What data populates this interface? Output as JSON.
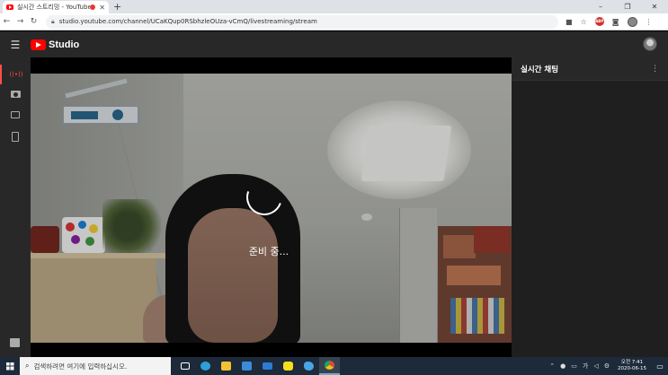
{
  "browser": {
    "tab_title": "실시간 스트리밍 - YouTube",
    "tab_close": "✕",
    "new_tab": "+",
    "window_controls": [
      "–",
      "❐",
      "✕"
    ],
    "url": "studio.youtube.com/channel/UCaKQup0RSbhzleOUza-vCmQ/livestreaming/stream",
    "adblock_badge": "ABP"
  },
  "studio": {
    "logo_text": "Studio",
    "hamburger": "☰"
  },
  "sidebar": {
    "items": [
      {
        "name": "stream",
        "icon": "live-broadcast-icon",
        "glyph": "((•))",
        "active": true
      },
      {
        "name": "webcam",
        "icon": "camera-icon",
        "active": false
      },
      {
        "name": "manage",
        "icon": "calendar-icon",
        "active": false
      },
      {
        "name": "mobile",
        "icon": "mobile-icon",
        "active": false
      }
    ],
    "feedback_icon": "feedback-icon"
  },
  "video": {
    "status_text": "준비 중..."
  },
  "chat": {
    "title": "실시간 채팅",
    "menu": "⋮"
  },
  "taskbar": {
    "search_placeholder": "검색하려면 여기에 입력하십시오.",
    "apps": [
      {
        "icon": "task-view-icon",
        "color": "#ffffff"
      },
      {
        "icon": "edge-icon",
        "color": "#2f9fd8"
      },
      {
        "icon": "file-explorer-icon",
        "color": "#f2c232"
      },
      {
        "icon": "store-icon",
        "color": "#3d8ad9"
      },
      {
        "icon": "mail-icon",
        "color": "#2c7cd6"
      },
      {
        "icon": "kakaotalk-icon",
        "color": "#f7df1e"
      },
      {
        "icon": "twitter-icon",
        "color": "#4aa3e6"
      },
      {
        "icon": "chrome-icon",
        "color": "#dd4b39"
      }
    ],
    "tray": {
      "ime": "가",
      "time_label": "오전 7:41",
      "date": "2020-06-15"
    }
  },
  "colors": {
    "studio_bg": "#282828",
    "accent": "#ff4e45",
    "taskbar": "#1c2a3a"
  }
}
